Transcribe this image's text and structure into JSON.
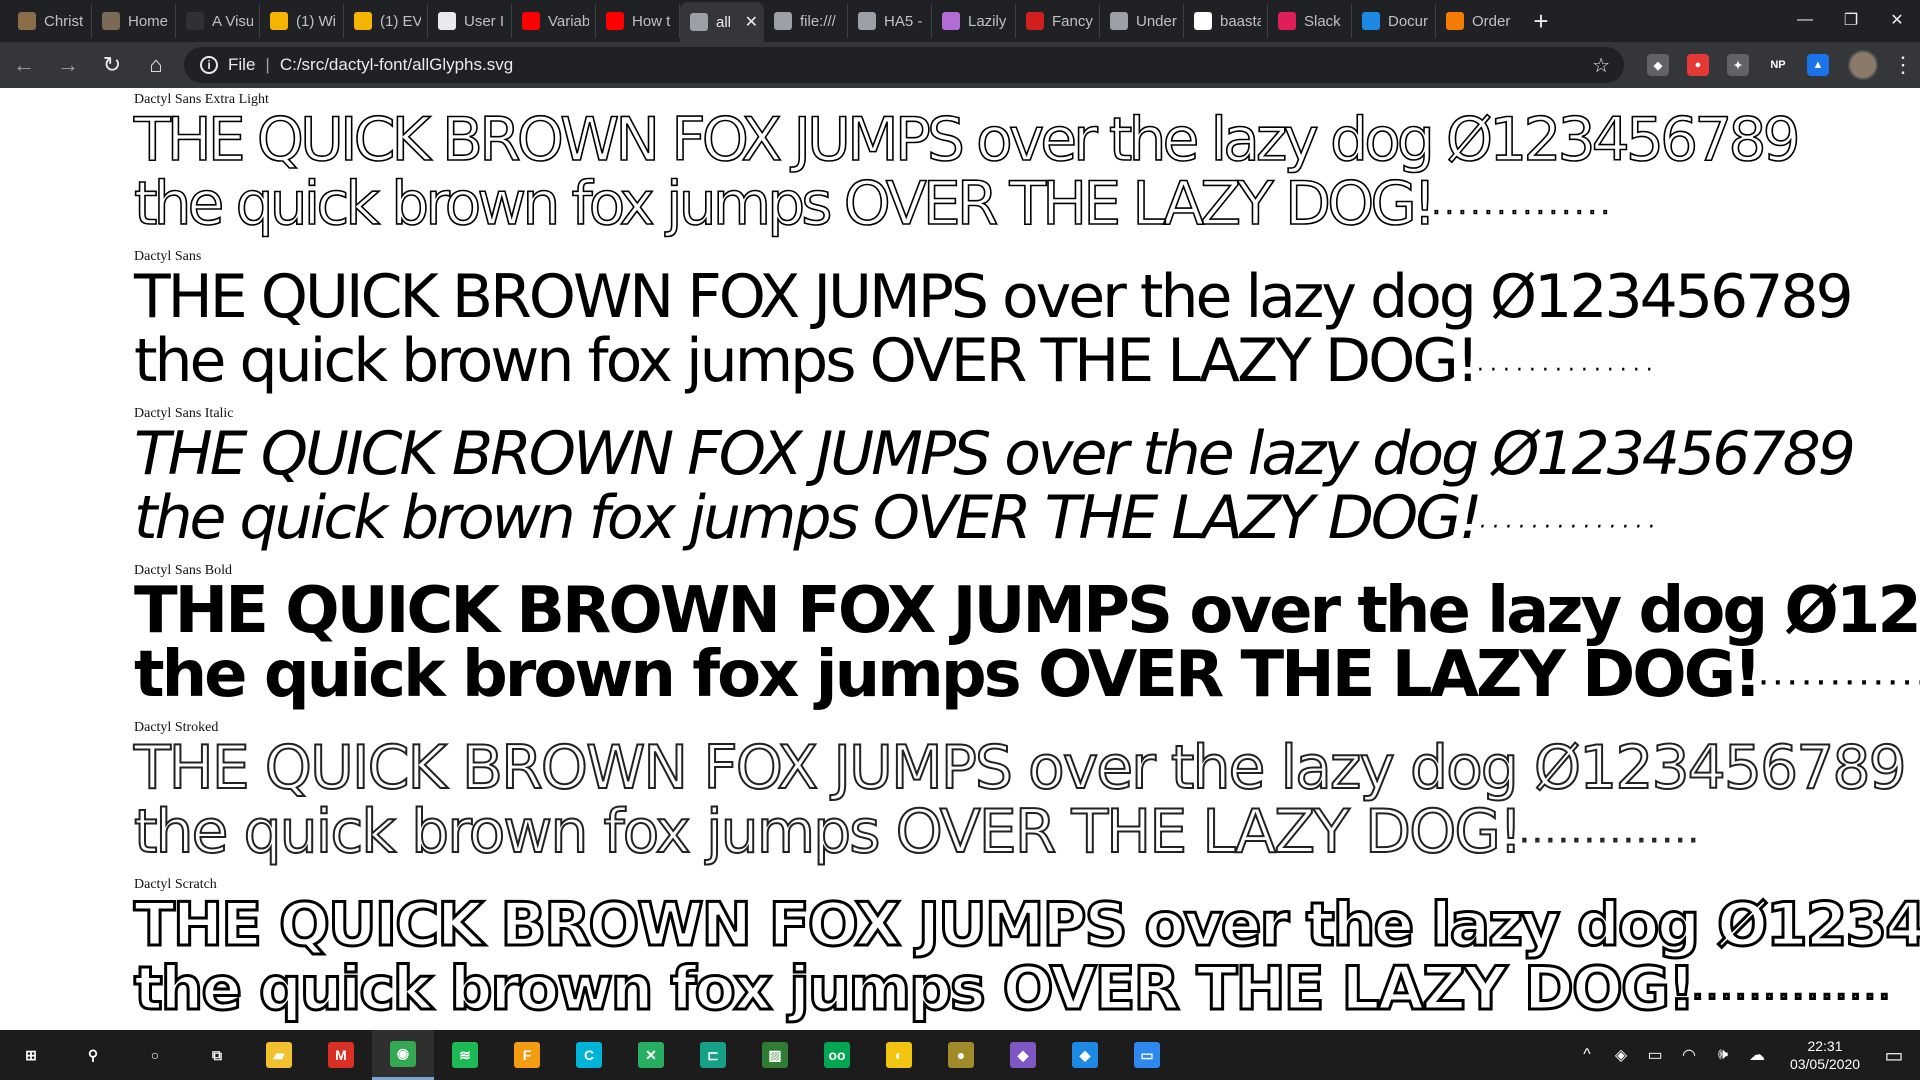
{
  "browser": {
    "tabs": [
      {
        "title": "Christ",
        "icon": "image-icon",
        "color": "#8b6d4a"
      },
      {
        "title": "Home",
        "icon": "image-icon",
        "color": "#7b6a55"
      },
      {
        "title": "A Visu",
        "icon": "circle-dark-icon",
        "color": "#303134"
      },
      {
        "title": "(1) Wi",
        "icon": "g-icon",
        "color": "#f4b400"
      },
      {
        "title": "(1) EV",
        "icon": "g-icon",
        "color": "#f4b400"
      },
      {
        "title": "User I",
        "icon": "doc-icon",
        "color": "#e8eaed"
      },
      {
        "title": "Variab",
        "icon": "youtube-icon",
        "color": "#ff0000"
      },
      {
        "title": "How t",
        "icon": "youtube-icon",
        "color": "#ff0000"
      },
      {
        "title": "all",
        "icon": "globe-icon",
        "color": "#9aa0a6",
        "active": true
      },
      {
        "title": "file:///",
        "icon": "globe-icon",
        "color": "#9aa0a6"
      },
      {
        "title": "HA5 -",
        "icon": "dots-icon",
        "color": "#9aa0a6"
      },
      {
        "title": "Lazily",
        "icon": "cursor-icon",
        "color": "#b36bd6"
      },
      {
        "title": "Fancy",
        "icon": "red-square-icon",
        "color": "#d11f1f"
      },
      {
        "title": "Under",
        "icon": "globe-icon",
        "color": "#9aa0a6"
      },
      {
        "title": "baasta",
        "icon": "m-icon",
        "color": "#ffffff"
      },
      {
        "title": "Slack",
        "icon": "slack-icon",
        "color": "#e01e5a"
      },
      {
        "title": "Docur",
        "icon": "3d-icon",
        "color": "#1e88e5"
      },
      {
        "title": "Order",
        "icon": "s-icon",
        "color": "#f57c00"
      }
    ],
    "new_tab": "+",
    "window_controls": {
      "minimize": "—",
      "restore": "❐",
      "close": "✕"
    },
    "nav": {
      "back": "←",
      "forward": "→",
      "reload": "↻",
      "home": "⌂"
    },
    "address": {
      "info": "i",
      "scheme": "File",
      "separator": "|",
      "url": "C:/src/dactyl-font/allGlyphs.svg"
    },
    "extensions": [
      {
        "name": "shield-extension-icon",
        "color": "#5f6368",
        "label": "◆"
      },
      {
        "name": "red-extension-icon",
        "color": "#e53935",
        "label": "●"
      },
      {
        "name": "puzzle-extension-icon",
        "color": "#5f6368",
        "label": "✦"
      },
      {
        "name": "np-extension-icon",
        "color": "#35363a",
        "label": "NP"
      },
      {
        "name": "drop-extension-icon",
        "color": "#1a73e8",
        "label": "▲"
      }
    ],
    "menu": "⋮"
  },
  "page": {
    "line1": "THE QUICK BROWN FOX JUMPS over the lazy dog Ø123456789",
    "line2": "the quick brown fox  jumps OVER THE LAZY DOG!",
    "dots": "..............",
    "fonts": [
      {
        "caption": "Dactyl Sans Extra Light"
      },
      {
        "caption": "Dactyl Sans"
      },
      {
        "caption": "Dactyl Sans Italic"
      },
      {
        "caption": "Dactyl Sans Bold"
      },
      {
        "caption": "Dactyl Stroked"
      },
      {
        "caption": "Dactyl Scratch"
      }
    ]
  },
  "taskbar": {
    "apps": [
      {
        "name": "start-button",
        "label": "⊞",
        "color": "#1c1c1c"
      },
      {
        "name": "search-button",
        "label": "⚲",
        "color": "#1c1c1c"
      },
      {
        "name": "cortana-button",
        "label": "○",
        "color": "#1c1c1c"
      },
      {
        "name": "task-view-button",
        "label": "⧉",
        "color": "#1c1c1c"
      },
      {
        "name": "file-explorer-app",
        "label": "▰",
        "color": "#f2c12e"
      },
      {
        "name": "gmail-app",
        "label": "M",
        "color": "#d93025"
      },
      {
        "name": "chrome-app",
        "label": "◉",
        "color": "#34a853",
        "active": true
      },
      {
        "name": "spotify-app",
        "label": "≋",
        "color": "#1db954"
      },
      {
        "name": "f-app",
        "label": "F",
        "color": "#f39c12"
      },
      {
        "name": "c-app",
        "label": "C",
        "color": "#00b4d8"
      },
      {
        "name": "x-app",
        "label": "✕",
        "color": "#27ae60"
      },
      {
        "name": "terminal-app",
        "label": "⊏",
        "color": "#16a085"
      },
      {
        "name": "image-app",
        "label": "▨",
        "color": "#2e7d32"
      },
      {
        "name": "tape-app",
        "label": "oo",
        "color": "#00a651"
      },
      {
        "name": "bulb-app",
        "label": "◐",
        "color": "#f1c40f"
      },
      {
        "name": "ball-app",
        "label": "●",
        "color": "#a08a2a"
      },
      {
        "name": "visual-studio-app",
        "label": "◆",
        "color": "#7e57c2"
      },
      {
        "name": "vscode-app",
        "label": "◆",
        "color": "#1e88e5"
      },
      {
        "name": "window-app",
        "label": "▭",
        "color": "#2d89ef"
      }
    ],
    "tray": {
      "chevron": "^",
      "dropbox": "◈",
      "battery": "▭",
      "wifi": "◠",
      "volume": "🕪",
      "cloud": "☁",
      "time": "22:31",
      "date": "03/05/2020",
      "notifications": "▭"
    }
  },
  "colors": {
    "tabstrip": "#202124",
    "toolbar": "#35363a",
    "omnibox": "#202124",
    "taskbar": "#1c1c1c"
  }
}
